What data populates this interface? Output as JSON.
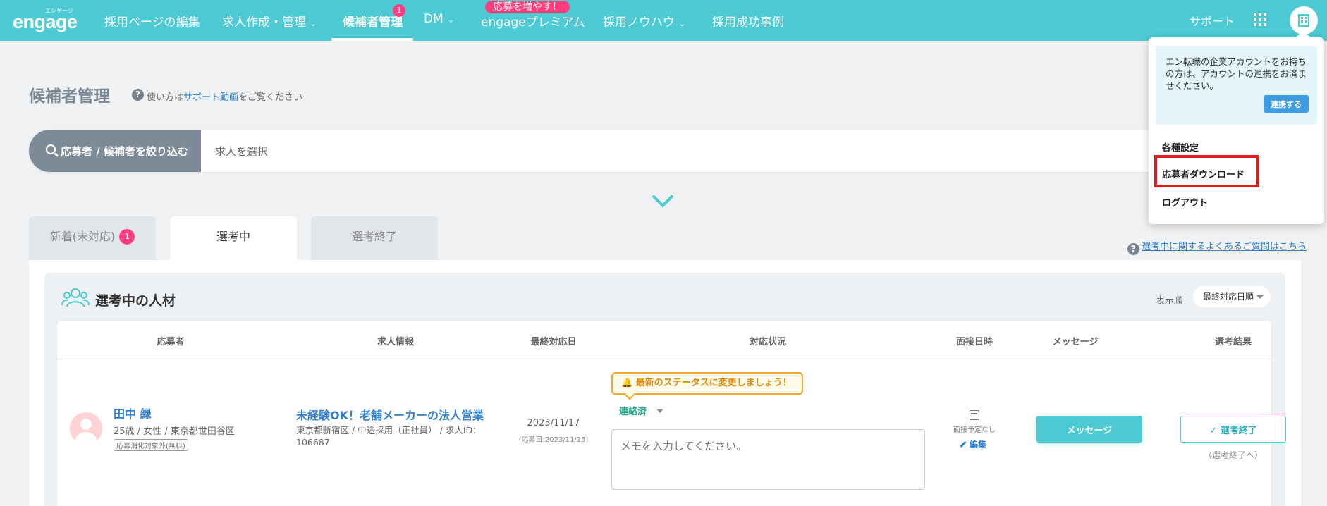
{
  "header": {
    "logo_sub": "エンゲージ",
    "logo_main": "engage",
    "nav": [
      {
        "label": "採用ページの編集"
      },
      {
        "label": "求人作成・管理"
      },
      {
        "label": "候補者管理",
        "badge": "1"
      },
      {
        "label": "DM"
      },
      {
        "label": "engageプレミアム",
        "promo": "応募を増やす！"
      },
      {
        "label": "採用ノウハウ"
      },
      {
        "label": "採用成功事例"
      }
    ],
    "support": "サポート"
  },
  "page": {
    "title": "候補者管理",
    "help_prefix": "使い方は",
    "help_link": "サポート動画",
    "help_suffix": "をご覧ください"
  },
  "search": {
    "button_label": "応募者 / 候補者を絞り込む",
    "job_placeholder": "求人を選択"
  },
  "tabs": [
    {
      "label": "新着(未対応)",
      "badge": "1"
    },
    {
      "label": "選考中"
    },
    {
      "label": "選考終了"
    }
  ],
  "faq_link": "選考中に関するよくあるご質問はこちら",
  "section": {
    "title": "選考中の人材",
    "sort_label": "表示順",
    "sort_value": "最終対応日順"
  },
  "table": {
    "headers": [
      "応募者",
      "求人情報",
      "最終対応日",
      "対応状況",
      "面接日時",
      "メッセージ",
      "選考結果"
    ],
    "rows": [
      {
        "name": "田中 緑",
        "meta": "25歳 / 女性 / 東京都世田谷区",
        "tag": "応募消化対象外(無料)",
        "job_title": "未経験OK！老舗メーカーの法人営業",
        "job_meta": "東京都新宿区 / 中途採用（正社員） / 求人ID：106687",
        "last_date": "2023/11/17",
        "applied_date": "(応募日:2023/11/15)",
        "status_tip": "最新のステータスに変更しましょう！",
        "status": "連絡済",
        "memo_placeholder": "メモを入力してください。",
        "interview": "面接予定なし",
        "edit": "編集",
        "message_button": "メッセージ",
        "result_button": "✓ 選考終了",
        "result_sub": "（選考終了へ）"
      }
    ]
  },
  "dropdown": {
    "notice": "エン転職の企業アカウントをお持ちの方は、アカウントの連携をお済ませください。",
    "link_button": "連携する",
    "items": [
      "各種設定",
      "応募者ダウンロード",
      "ログアウト"
    ]
  },
  "colors": {
    "brand": "#4dcad3",
    "badge": "#ff3d7f",
    "highlight": "#e0171b"
  }
}
